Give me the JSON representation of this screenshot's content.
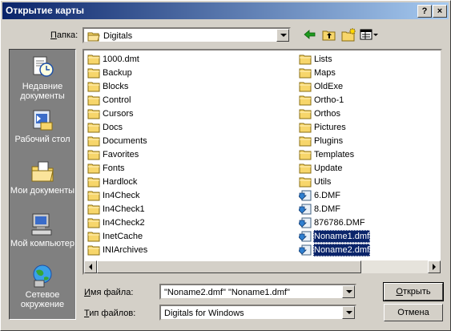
{
  "window": {
    "title": "Открытие карты",
    "help_glyph": "?",
    "close_glyph": "×"
  },
  "lookin": {
    "label_u": "П",
    "label_rest": "апка:",
    "value": "Digitals"
  },
  "places": [
    {
      "name": "recent",
      "label": "Недавние документы"
    },
    {
      "name": "desktop",
      "label": "Рабочий стол"
    },
    {
      "name": "mydocs",
      "label": "Мои документы"
    },
    {
      "name": "mycomputer",
      "label": "Мой компьютер"
    },
    {
      "name": "network",
      "label": "Сетевое окружение"
    }
  ],
  "files_col1": [
    {
      "name": "1000.dmt",
      "type": "folder"
    },
    {
      "name": "Backup",
      "type": "folder"
    },
    {
      "name": "Blocks",
      "type": "folder"
    },
    {
      "name": "Control",
      "type": "folder"
    },
    {
      "name": "Cursors",
      "type": "folder"
    },
    {
      "name": "Docs",
      "type": "folder"
    },
    {
      "name": "Documents",
      "type": "folder"
    },
    {
      "name": "Favorites",
      "type": "folder"
    },
    {
      "name": "Fonts",
      "type": "folder"
    },
    {
      "name": "Hardlock",
      "type": "folder"
    },
    {
      "name": "In4Check",
      "type": "folder"
    },
    {
      "name": "In4Check1",
      "type": "folder"
    },
    {
      "name": "In4Check2",
      "type": "folder"
    },
    {
      "name": "InetCache",
      "type": "folder"
    },
    {
      "name": "INIArchives",
      "type": "folder"
    }
  ],
  "files_col2": [
    {
      "name": "Lists",
      "type": "folder"
    },
    {
      "name": "Maps",
      "type": "folder"
    },
    {
      "name": "OldExe",
      "type": "folder"
    },
    {
      "name": "Ortho-1",
      "type": "folder"
    },
    {
      "name": "Orthos",
      "type": "folder"
    },
    {
      "name": "Pictures",
      "type": "folder"
    },
    {
      "name": "Plugins",
      "type": "folder"
    },
    {
      "name": "Templates",
      "type": "folder"
    },
    {
      "name": "Update",
      "type": "folder"
    },
    {
      "name": "Utils",
      "type": "folder"
    },
    {
      "name": "6.DMF",
      "type": "dmf"
    },
    {
      "name": "8.DMF",
      "type": "dmf"
    },
    {
      "name": "876786.DMF",
      "type": "dmf"
    },
    {
      "name": "Noname1.dmf",
      "type": "dmf",
      "selected": true
    },
    {
      "name": "Noname2.dmf",
      "type": "dmf",
      "selected": true
    }
  ],
  "filename": {
    "label_u": "И",
    "label_rest": "мя файла:",
    "value": "\"Noname2.dmf\" \"Noname1.dmf\""
  },
  "filetype": {
    "label_u": "Т",
    "label_rest": "ип файлов:",
    "value": "Digitals for Windows"
  },
  "buttons": {
    "open_u": "О",
    "open_rest": "ткрыть",
    "cancel": "Отмена"
  },
  "colors": {
    "title_start": "#0a246a",
    "title_end": "#a6caf0",
    "folder": "#f7d66b",
    "selection": "#0a246a"
  }
}
